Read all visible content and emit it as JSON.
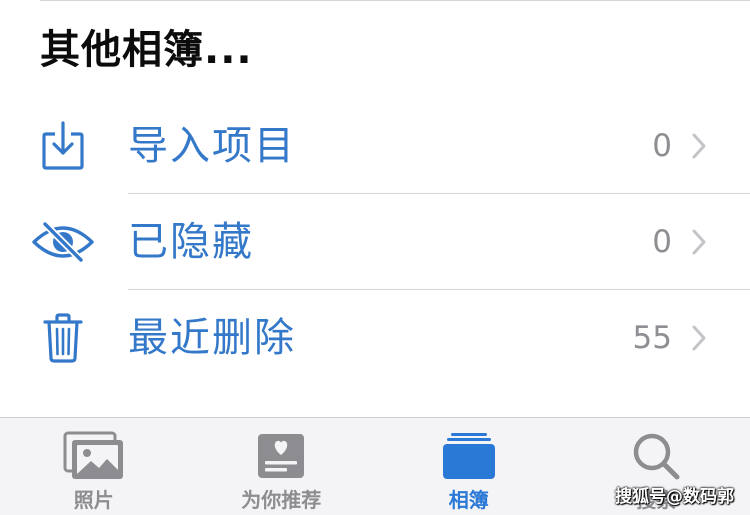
{
  "section": {
    "title": "其他相簿..."
  },
  "rows": [
    {
      "label": "导入项目",
      "count": "0",
      "icon": "import-icon"
    },
    {
      "label": "已隐藏",
      "count": "0",
      "icon": "eye-slash-icon"
    },
    {
      "label": "最近删除",
      "count": "55",
      "icon": "trash-icon"
    }
  ],
  "tabs": [
    {
      "label": "照片",
      "icon": "photos-icon",
      "active": false
    },
    {
      "label": "为你推荐",
      "icon": "for-you-icon",
      "active": false
    },
    {
      "label": "相簿",
      "icon": "albums-icon",
      "active": true
    },
    {
      "label": "搜索",
      "icon": "search-icon",
      "active": false
    }
  ],
  "watermark": "搜狐号@数码郭",
  "colors": {
    "accent": "#3478c9",
    "tab_active": "#2b79d6",
    "tab_inactive": "#8c8c91",
    "count_gray": "#8e8e93"
  }
}
